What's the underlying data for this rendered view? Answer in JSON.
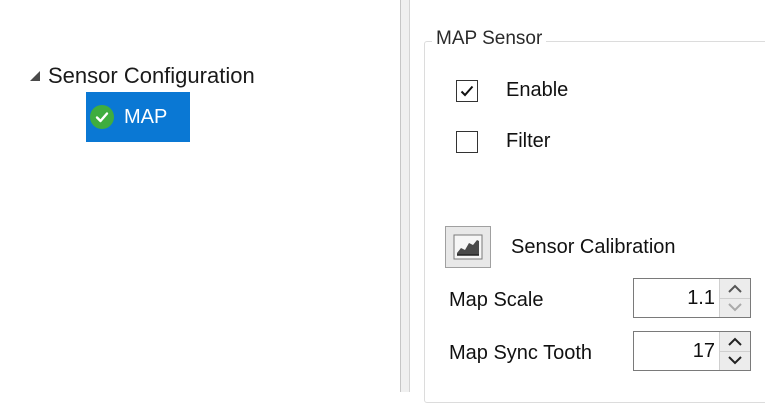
{
  "tree": {
    "root_label": "Sensor Configuration",
    "child_label": "MAP"
  },
  "panel": {
    "group_title": "MAP Sensor",
    "enable": {
      "label": "Enable",
      "checked": true
    },
    "filter": {
      "label": "Filter",
      "checked": false
    },
    "calibration_label": "Sensor Calibration",
    "map_scale": {
      "label": "Map Scale",
      "value": "1.1"
    },
    "map_sync_tooth": {
      "label": "Map Sync Tooth",
      "value": "17"
    }
  },
  "colors": {
    "selection": "#0a78d4",
    "status_ok": "#3fad3f"
  },
  "icons": {
    "expander": "expanded-triangle-icon",
    "status": "check-circle-icon",
    "calibration": "chart-icon"
  }
}
